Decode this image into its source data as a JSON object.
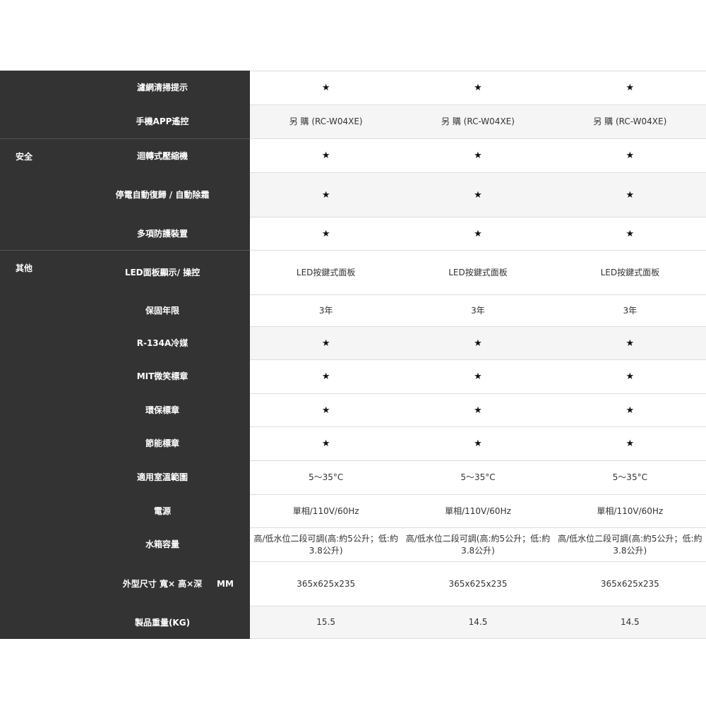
{
  "rows": [
    {
      "category": "",
      "feature": "濾網清掃提示",
      "unit": "",
      "values": [
        "★",
        "★",
        "★"
      ],
      "h": 48,
      "shade": false,
      "sep": false
    },
    {
      "category": "",
      "feature": "手機APP遙控",
      "unit": "",
      "values": [
        "另 購 (RC-W04XE)",
        "另 購 (RC-W04XE)",
        "另 購 (RC-W04XE)"
      ],
      "h": 48,
      "shade": true,
      "sep": false
    },
    {
      "category": "安全",
      "feature": "迴轉式壓縮機",
      "unit": "",
      "values": [
        "★",
        "★",
        "★"
      ],
      "h": 48,
      "shade": false,
      "sep": true
    },
    {
      "category": "",
      "feature": "停電自動復歸 / 自動除霜",
      "unit": "",
      "values": [
        "★",
        "★",
        "★"
      ],
      "h": 63,
      "shade": true,
      "sep": false
    },
    {
      "category": "",
      "feature": "多項防護裝置",
      "unit": "",
      "values": [
        "★",
        "★",
        "★"
      ],
      "h": 47,
      "shade": false,
      "sep": false
    },
    {
      "category": "其他",
      "feature": "LED面板顯示/ 操控",
      "unit": "",
      "values": [
        "LED按鍵式面板",
        "LED按鍵式面板",
        "LED按鍵式面板"
      ],
      "h": 63,
      "shade": false,
      "sep": true
    },
    {
      "category": "",
      "feature": "保固年限",
      "unit": "",
      "values": [
        "3年",
        "3年",
        "3年"
      ],
      "h": 45,
      "shade": false,
      "sep": false
    },
    {
      "category": "",
      "feature": "R-134A冷媒",
      "unit": "",
      "values": [
        "★",
        "★",
        "★"
      ],
      "h": 47,
      "shade": true,
      "sep": false
    },
    {
      "category": "",
      "feature": "MIT微笑標章",
      "unit": "",
      "values": [
        "★",
        "★",
        "★"
      ],
      "h": 48,
      "shade": false,
      "sep": false
    },
    {
      "category": "",
      "feature": "環保標章",
      "unit": "",
      "values": [
        "★",
        "★",
        "★"
      ],
      "h": 47,
      "shade": false,
      "sep": false
    },
    {
      "category": "",
      "feature": "節能標章",
      "unit": "",
      "values": [
        "★",
        "★",
        "★"
      ],
      "h": 48,
      "shade": false,
      "sep": false
    },
    {
      "category": "",
      "feature": "適用室溫範圍",
      "unit": "",
      "values": [
        "5～35°C",
        "5～35°C",
        "5～35°C"
      ],
      "h": 48,
      "shade": false,
      "sep": false
    },
    {
      "category": "",
      "feature": "電源",
      "unit": "",
      "values": [
        "單相/110V/60Hz",
        "單相/110V/60Hz",
        "單相/110V/60Hz"
      ],
      "h": 47,
      "shade": false,
      "sep": false
    },
    {
      "category": "",
      "feature": "水箱容量",
      "unit": "",
      "values": [
        "高/低水位二段可調(高:約5公升；低:約3.8公升)",
        "高/低水位二段可調(高:約5公升；低:約3.8公升)",
        "高/低水位二段可調(高:約5公升；低:約3.8公升)"
      ],
      "h": 48,
      "shade": false,
      "sep": false
    },
    {
      "category": "",
      "feature": "外型尺寸 寬× 高×深",
      "unit": "MM",
      "values": [
        "365x625x235",
        "365x625x235",
        "365x625x235"
      ],
      "h": 63,
      "shade": false,
      "sep": false
    },
    {
      "category": "",
      "feature": "製品重量(KG)",
      "unit": "",
      "values": [
        "15.5",
        "14.5",
        "14.5"
      ],
      "h": 47,
      "shade": true,
      "sep": false
    }
  ]
}
